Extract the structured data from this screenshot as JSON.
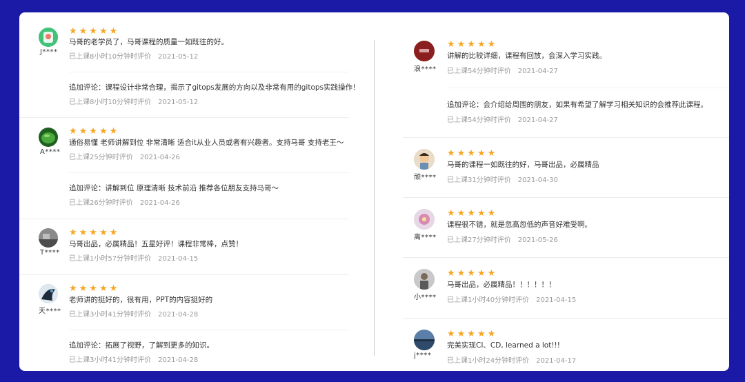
{
  "colors": {
    "frame": "#1a1aa6",
    "star": "#f6a623",
    "text": "#333333",
    "meta": "#9a9a9a"
  },
  "star_glyph": "★★★★★",
  "left_reviews": [
    {
      "user": "J****",
      "avatar": "green-app-icon",
      "content": "马哥的老学员了，马哥课程的质量一如既往的好。",
      "time": "已上课8小时10分钟时评价",
      "date": "2021-05-12",
      "followup": "追加评论：课程设计非常合理，揭示了gitops发展的方向以及非常有用的gitops实践操作！",
      "followup_time": "已上课8小时10分钟时评价",
      "followup_date": "2021-05-12"
    },
    {
      "user": "A****",
      "avatar": "green-leaf-avatar",
      "content": "通俗易懂 老师讲解到位 非常清晰 适合it从业人员或者有兴趣者。支持马哥 支持老王～",
      "time": "已上课25分钟时评价",
      "date": "2021-04-26",
      "followup": "追加评论：讲解到位 原理清晰 技术前沿 推荐各位朋友支持马哥～",
      "followup_time": "已上课26分钟时评价",
      "followup_date": "2021-04-26"
    },
    {
      "user": "T****",
      "avatar": "gray-photo-avatar",
      "content": "马哥出品，必属精品！五星好评！课程非常棒，点赞！",
      "time": "已上课1小时57分钟时评价",
      "date": "2021-04-15"
    },
    {
      "user": "天****",
      "avatar": "dark-bird-avatar",
      "content": "老师讲的挺好的，很有用，PPT的内容挺好的",
      "time": "已上课3小时41分钟时评价",
      "date": "2021-04-28",
      "followup": "追加评论：拓展了视野，了解到更多的知识。",
      "followup_time": "已上课3小时41分钟时评价",
      "followup_date": "2021-04-28"
    }
  ],
  "right_reviews": [
    {
      "user": "浪****",
      "avatar": "red-emblem-avatar",
      "content": "讲解的比较详细，课程有回放，会深入学习实践。",
      "time": "已上课54分钟时评价",
      "date": "2021-04-27",
      "followup": "追加评论：会介绍给周围的朋友，如果有希望了解学习相关知识的会推荐此课程。",
      "followup_time": "已上课54分钟时评价",
      "followup_date": "2021-04-27"
    },
    {
      "user": "顽****",
      "avatar": "cartoon-kid-avatar",
      "content": "马哥的课程一如既往的好，马哥出品，必属精品",
      "time": "已上课31分钟时评价",
      "date": "2021-04-30"
    },
    {
      "user": "离****",
      "avatar": "pink-flower-avatar",
      "content": "课程很不错，就是忽高忽低的声音好难受啊。",
      "time": "已上课27分钟时评价",
      "date": "2021-05-26"
    },
    {
      "user": "小****",
      "avatar": "person-photo-avatar",
      "content": "马哥出品，必属精品！！！！！！",
      "time": "已上课1小时40分钟时评价",
      "date": "2021-04-15"
    },
    {
      "user": "j****",
      "avatar": "lake-photo-avatar",
      "content": "完美实现CI、CD, learned a lot!!!",
      "time": "已上课1小时24分钟时评价",
      "date": "2021-04-17"
    }
  ]
}
